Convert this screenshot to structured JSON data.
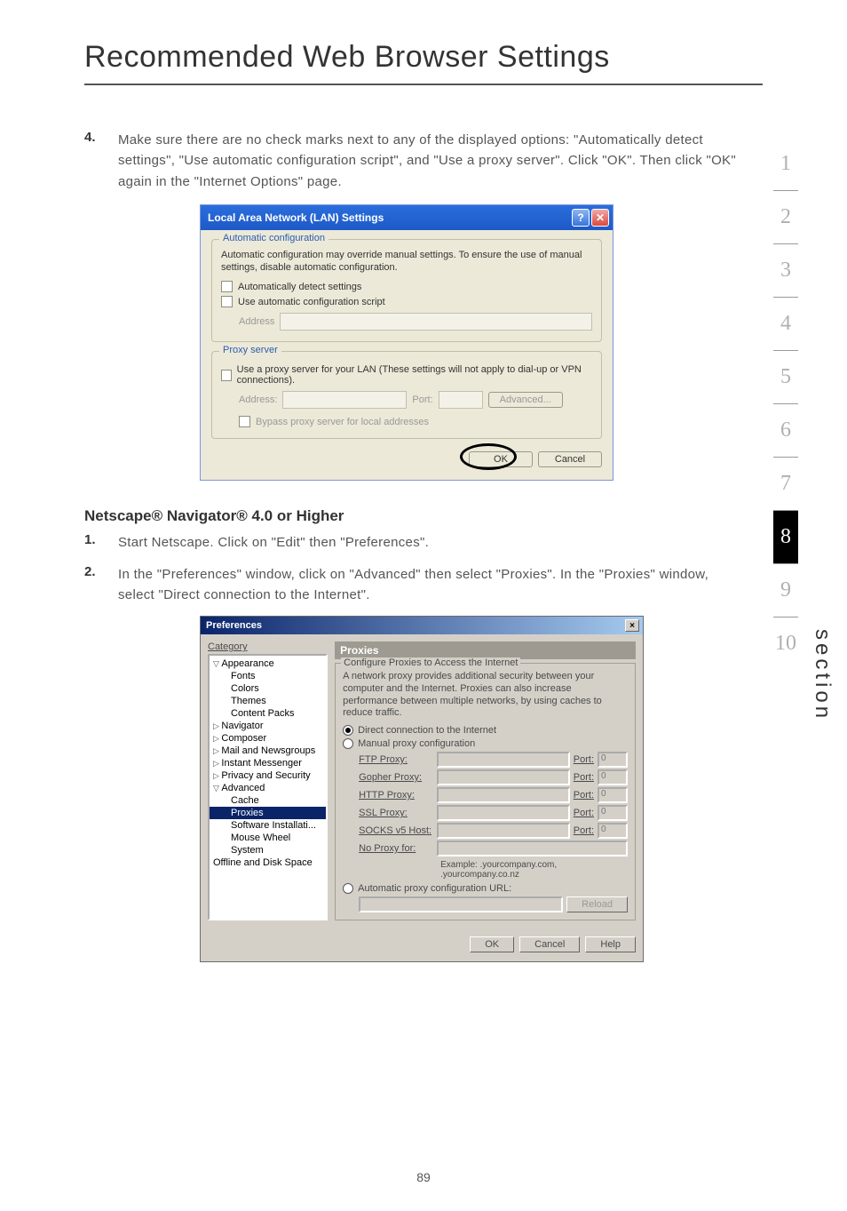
{
  "page": {
    "title": "Recommended Web Browser Settings",
    "number": "89",
    "section_label": "section"
  },
  "step4": {
    "num": "4.",
    "text": "Make sure there are no check marks next to any of the displayed options: \"Automatically detect settings\", \"Use automatic configuration script\", and \"Use a proxy server\". Click \"OK\". Then click \"OK\" again in the \"Internet Options\" page."
  },
  "lan": {
    "title": "Local Area Network (LAN) Settings",
    "group1": {
      "legend": "Automatic configuration",
      "desc": "Automatic configuration may override manual settings.  To ensure the use of manual settings, disable automatic configuration.",
      "chk1": "Automatically detect settings",
      "chk2": "Use automatic configuration script",
      "addr_label": "Address"
    },
    "group2": {
      "legend": "Proxy server",
      "chk": "Use a proxy server for your LAN (These settings will not apply to dial-up or VPN connections).",
      "addr_label": "Address:",
      "port_label": "Port:",
      "advanced": "Advanced...",
      "bypass": "Bypass proxy server for local addresses"
    },
    "ok": "OK",
    "cancel": "Cancel"
  },
  "netscape": {
    "heading": "Netscape® Navigator® 4.0 or Higher",
    "step1": {
      "num": "1.",
      "text": "Start Netscape. Click on \"Edit\" then \"Preferences\"."
    },
    "step2": {
      "num": "2.",
      "text": "In the \"Preferences\" window, click on \"Advanced\" then select \"Proxies\". In the \"Proxies\" window, select \"Direct connection to the Internet\"."
    }
  },
  "prefs": {
    "title": "Preferences",
    "category_label": "Category",
    "tree": {
      "appearance": "Appearance",
      "fonts": "Fonts",
      "colors": "Colors",
      "themes": "Themes",
      "content_packs": "Content Packs",
      "navigator": "Navigator",
      "composer": "Composer",
      "mail": "Mail and Newsgroups",
      "im": "Instant Messenger",
      "privacy": "Privacy and Security",
      "advanced": "Advanced",
      "cache": "Cache",
      "proxies": "Proxies",
      "software": "Software Installati...",
      "mouse": "Mouse Wheel",
      "system": "System",
      "offline": "Offline and Disk Space"
    },
    "panel": {
      "title": "Proxies",
      "legend": "Configure Proxies to Access the Internet",
      "desc": "A network proxy provides additional security between your computer and the Internet. Proxies can also increase performance between multiple networks, by using caches to reduce traffic.",
      "radio_direct": "Direct connection to the Internet",
      "radio_manual": "Manual proxy configuration",
      "ftp": "FTP Proxy:",
      "gopher": "Gopher Proxy:",
      "http": "HTTP Proxy:",
      "ssl": "SSL Proxy:",
      "socks": "SOCKS v5 Host:",
      "noproxy": "No Proxy for:",
      "port": "Port:",
      "port_val": "0",
      "example": "Example: .yourcompany.com, .yourcompany.co.nz",
      "radio_auto": "Automatic proxy configuration URL:",
      "reload": "Reload"
    },
    "ok": "OK",
    "cancel": "Cancel",
    "help": "Help"
  },
  "nav": {
    "items": [
      "1",
      "2",
      "3",
      "4",
      "5",
      "6",
      "7",
      "8",
      "9",
      "10"
    ],
    "active_index": 7
  }
}
